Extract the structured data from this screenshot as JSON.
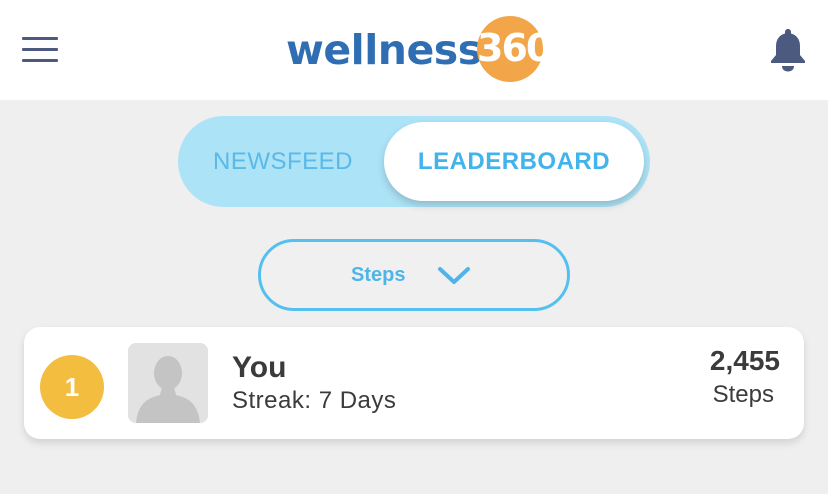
{
  "header": {
    "logo_text": "wellness",
    "logo_number": "360",
    "menu_icon": "hamburger-icon",
    "notification_icon": "bell-icon"
  },
  "tabs": {
    "newsfeed_label": "NEWSFEED",
    "leaderboard_label": "LEADERBOARD",
    "active": "LEADERBOARD"
  },
  "filter": {
    "selected": "Steps",
    "icon": "chevron-down-icon"
  },
  "leaderboard": {
    "entries": [
      {
        "rank": "1",
        "name": "You",
        "streak": "Streak: 7 Days",
        "value": "2,455",
        "unit": "Steps",
        "avatar_icon": "avatar-placeholder-icon"
      }
    ]
  },
  "colors": {
    "brand_blue": "#2f6eb3",
    "brand_orange": "#f2a649",
    "accent_light_blue": "#55c0ef",
    "toggle_bg": "#ade3f7",
    "rank_gold": "#f3bd3f",
    "icon_navy": "#4d5a80"
  }
}
